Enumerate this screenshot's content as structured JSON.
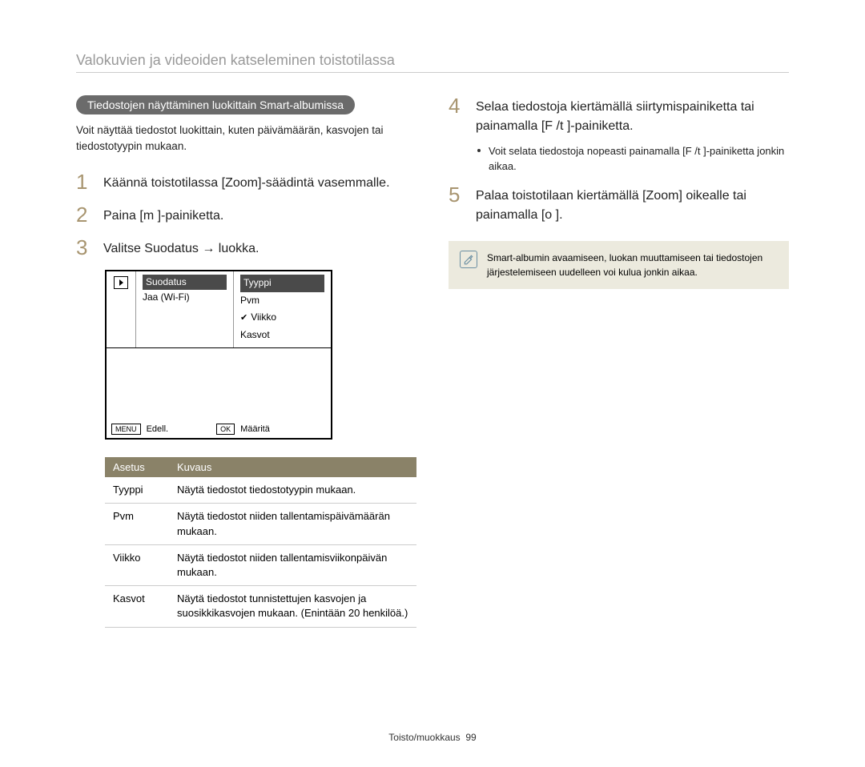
{
  "header": {
    "title": "Valokuvien ja videoiden katseleminen toistotilassa"
  },
  "leftCol": {
    "pill": "Tiedostojen näyttäminen luokittain Smart-albumissa",
    "intro": "Voit näyttää tiedostot luokittain, kuten päivämäärän, kasvojen tai tiedostotyypin mukaan.",
    "steps": {
      "n1": "1",
      "t1": "Käännä toistotilassa [Zoom]-säädintä vasemmalle.",
      "n2": "2",
      "t2": "Paina [m    ]-painiketta.",
      "n3": "3",
      "t3": "Valitse Suodatus → luokka."
    },
    "screen": {
      "leftActive": "Suodatus",
      "leftItem": "Jaa (Wi-Fi)",
      "rightActive": "Tyyppi",
      "rightItems": {
        "r1": "Pvm",
        "r2": "Viikko",
        "r3": "Kasvot"
      },
      "footer": {
        "menuBtn": "MENU",
        "menuLabel": "Edell.",
        "okBtn": "OK",
        "okLabel": "Määritä"
      }
    },
    "table": {
      "hdr1": "Asetus",
      "hdr2": "Kuvaus",
      "rows": {
        "r1c1": "Tyyppi",
        "r1c2": "Näytä tiedostot tiedostotyypin mukaan.",
        "r2c1": "Pvm",
        "r2c2": "Näytä tiedostot niiden tallentamispäivämäärän mukaan.",
        "r3c1": "Viikko",
        "r3c2": "Näytä tiedostot niiden tallentamisviikonpäivän mukaan.",
        "r4c1": "Kasvot",
        "r4c2": "Näytä tiedostot tunnistettujen kasvojen ja suosikkikasvojen mukaan. (Enintään 20 henkilöä.)"
      }
    }
  },
  "rightCol": {
    "steps": {
      "n4": "4",
      "t4": "Selaa tiedostoja kiertämällä siirtymispainiketta tai painamalla [F /t    ]-painiketta.",
      "bullet4": "Voit selata tiedostoja nopeasti painamalla [F /t    ]-painiketta jonkin aikaa.",
      "n5": "5",
      "t5": "Palaa toistotilaan kiertämällä [Zoom] oikealle tai painamalla [o    ]."
    },
    "note": "Smart-albumin avaamiseen, luokan muuttamiseen tai tiedostojen järjestelemiseen uudelleen voi kulua jonkin aikaa."
  },
  "footer": {
    "section": "Toisto/muokkaus",
    "page": "99"
  }
}
